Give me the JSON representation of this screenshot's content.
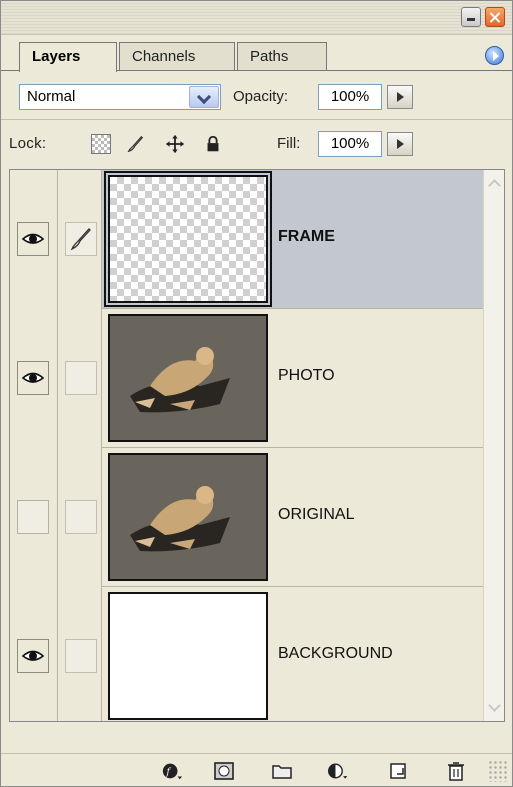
{
  "tabs": [
    {
      "label": "Layers",
      "active": true
    },
    {
      "label": "Channels",
      "active": false
    },
    {
      "label": "Paths",
      "active": false
    }
  ],
  "blend_mode": {
    "selected": "Normal"
  },
  "opacity": {
    "label": "Opacity:",
    "value": "100%"
  },
  "lock": {
    "label": "Lock:",
    "icons": [
      "lock-transparent-icon",
      "brush-icon",
      "move-icon",
      "padlock-icon"
    ]
  },
  "fill": {
    "label": "Fill:",
    "value": "100%"
  },
  "layers": [
    {
      "name": "FRAME",
      "visible": true,
      "linked_brush": true,
      "selected": true,
      "thumbnail": "transparent"
    },
    {
      "name": "PHOTO",
      "visible": true,
      "linked_brush": false,
      "selected": false,
      "thumbnail": "dog-photo"
    },
    {
      "name": "ORIGINAL",
      "visible": false,
      "linked_brush": false,
      "selected": false,
      "thumbnail": "dog-photo"
    },
    {
      "name": "BACKGROUND",
      "visible": true,
      "linked_brush": false,
      "selected": false,
      "thumbnail": "white"
    }
  ],
  "toolbar_icons": [
    "layer-style-icon",
    "layer-mask-icon",
    "new-group-icon",
    "adjustment-layer-icon",
    "new-layer-icon",
    "trash-icon"
  ],
  "colors": {
    "panel": "#ece9d8",
    "selected_row": "#c3c7d0",
    "field_border": "#7f9db9"
  }
}
